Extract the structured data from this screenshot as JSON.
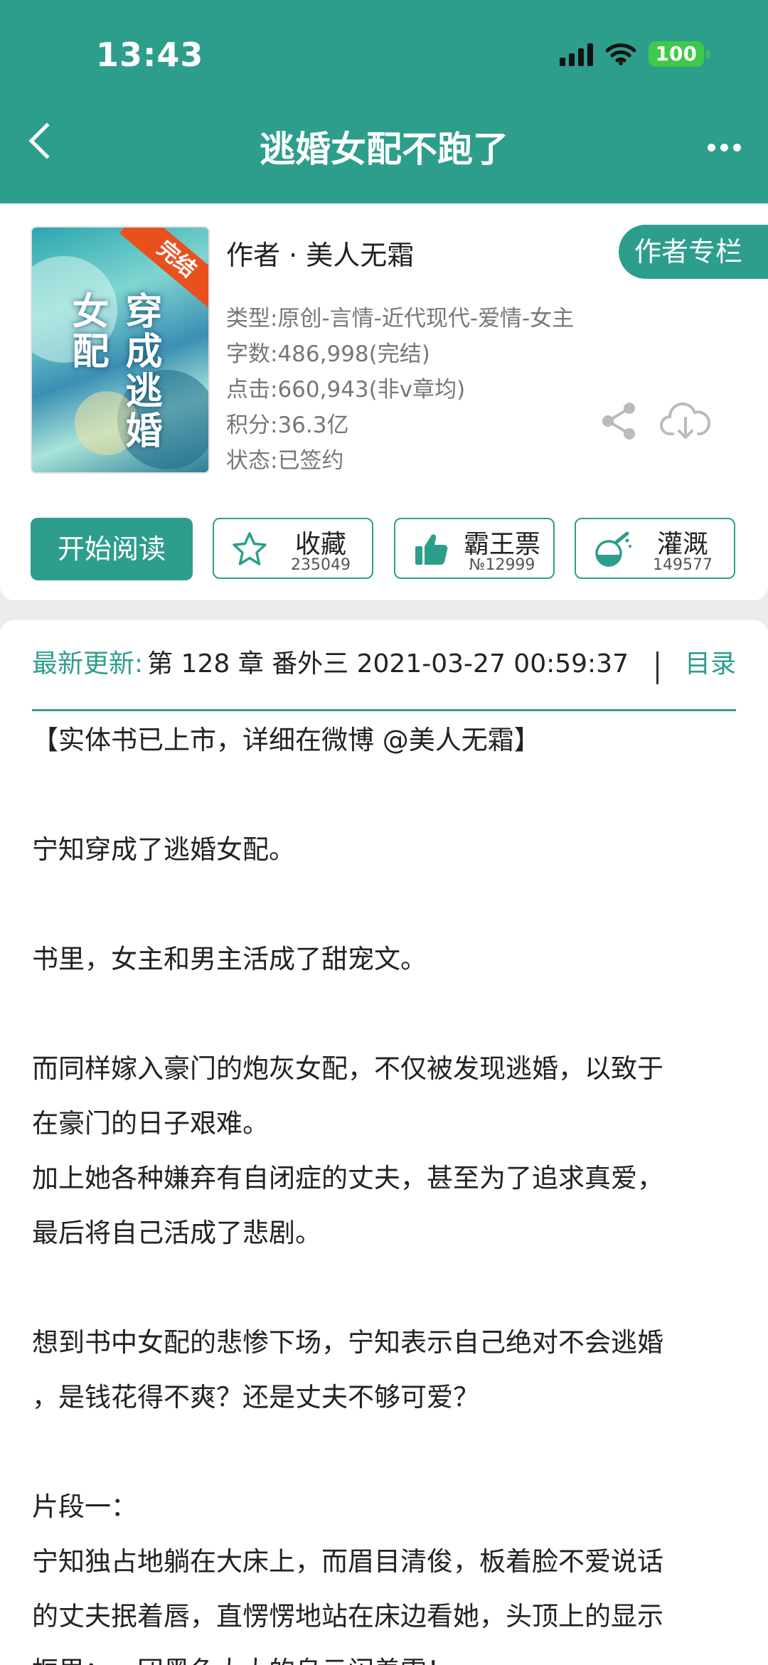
{
  "status_bar": {
    "time": "13:43",
    "battery": "100"
  },
  "header": {
    "title": "逃婚女配不跑了"
  },
  "book": {
    "cover_title": "穿成逃婚女配",
    "cover_badge": "完结",
    "author": "作者 · 美人无霜",
    "author_column_label": "作者专栏",
    "meta": [
      "类型:原创-言情-近代现代-爱情-女主",
      "字数:486,998(完结)",
      "点击:660,943(非v章均)",
      "积分:36.3亿",
      "状态:已签约"
    ]
  },
  "actions": {
    "read_label": "开始阅读",
    "favorite": {
      "label": "收藏",
      "count": "235049",
      "icon": "star-icon"
    },
    "vote": {
      "label": "霸王票",
      "count": "№12999",
      "icon": "thumbs-up-icon"
    },
    "water": {
      "label": "灌溉",
      "count": "149577",
      "icon": "watering-flask-icon"
    }
  },
  "latest": {
    "label": "最新更新:",
    "chapter": "第 128 章 番外三 2021-03-27 00:59:37",
    "toc_label": "目录"
  },
  "summary_lines": [
    "【实体书已上市，详细在微博 @美人无霜】",
    "",
    "宁知穿成了逃婚女配。",
    "",
    "书里，女主和男主活成了甜宠文。",
    "",
    "而同样嫁入豪门的炮灰女配，不仅被发现逃婚，以致于",
    "在豪门的日子艰难。",
    "加上她各种嫌弃有自闭症的丈夫，甚至为了追求真爱，",
    "最后将自己活成了悲剧。",
    "",
    "想到书中女配的悲惨下场，宁知表示自己绝对不会逃婚",
    "，是钱花得不爽？还是丈夫不够可爱？",
    "",
    "片段一：",
    "宁知独占地躺在大床上，而眉目清俊，板着脸不爱说话",
    "的丈夫抿着唇，直愣愣地站在床边看她，头顶上的显示",
    "框里：一团黑色大大的乌云闪着雷！"
  ],
  "colors": {
    "accent": "#2d9e8c",
    "badge": "#e8501e",
    "battery": "#3ec94b"
  }
}
